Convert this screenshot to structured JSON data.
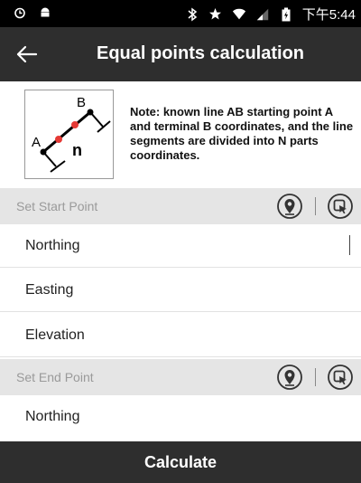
{
  "status_bar": {
    "time": "下午5:44",
    "icons": [
      "alarm-icon",
      "android-icon",
      "bluetooth-icon",
      "star-icon",
      "wifi-icon",
      "signal-icon",
      "battery-icon"
    ]
  },
  "app_bar": {
    "title": "Equal points calculation",
    "back_icon": "arrow-left-icon"
  },
  "note": {
    "text": "Note: known line AB starting point A and terminal B coordinates, and the line segments are divided into N parts coordinates.",
    "diagram": {
      "label_a": "A",
      "label_b": "B",
      "label_n": "n"
    }
  },
  "start_point": {
    "title": "Set Start Point",
    "fields": [
      {
        "label": "Northing",
        "value": ""
      },
      {
        "label": "Easting",
        "value": ""
      },
      {
        "label": "Elevation",
        "value": ""
      }
    ]
  },
  "end_point": {
    "title": "Set End Point",
    "fields": [
      {
        "label": "Northing",
        "value": ""
      }
    ]
  },
  "actions": {
    "calculate_label": "Calculate"
  },
  "colors": {
    "bar": "#2e2e2e",
    "section": "#e5e5e5",
    "section_text": "#9a9a9a",
    "diagram_red": "#e53935"
  }
}
